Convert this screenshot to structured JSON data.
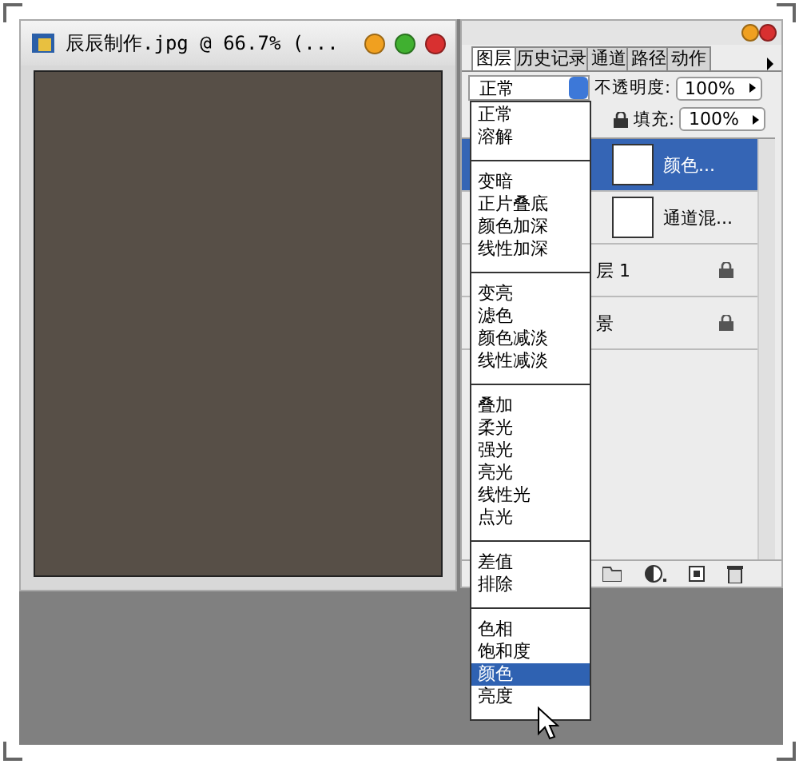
{
  "document_window": {
    "title": "辰辰制作.jpg @ 66.7% (..."
  },
  "layers_panel": {
    "tabs": [
      {
        "label": "图层",
        "selected": true
      },
      {
        "label": "历史记录",
        "selected": false
      },
      {
        "label": "通道",
        "selected": false
      },
      {
        "label": "路径",
        "selected": false
      },
      {
        "label": "动作",
        "selected": false
      }
    ],
    "blend_mode": "正常",
    "opacity_label": "不透明度:",
    "opacity": "100%",
    "fill_label": "填充:",
    "fill": "100%",
    "layers": [
      {
        "name": "颜色...",
        "kind": "adjustment",
        "selected": true,
        "locked": false
      },
      {
        "name": "通道混...",
        "kind": "adjustment",
        "selected": false,
        "locked": false
      },
      {
        "name": "层 1",
        "kind": "pixel",
        "selected": false,
        "locked": true
      },
      {
        "name": "景",
        "kind": "pixel",
        "selected": false,
        "locked": true
      }
    ]
  },
  "blend_menu": {
    "groups": [
      {
        "items": [
          {
            "label": "正常",
            "selected": false
          },
          {
            "label": "溶解",
            "selected": false
          }
        ]
      },
      {
        "items": [
          {
            "label": "变暗",
            "selected": false
          },
          {
            "label": "正片叠底",
            "selected": false
          },
          {
            "label": "颜色加深",
            "selected": false
          },
          {
            "label": "线性加深",
            "selected": false
          }
        ]
      },
      {
        "items": [
          {
            "label": "变亮",
            "selected": false
          },
          {
            "label": "滤色",
            "selected": false
          },
          {
            "label": "颜色减淡",
            "selected": false
          },
          {
            "label": "线性减淡",
            "selected": false
          }
        ]
      },
      {
        "items": [
          {
            "label": "叠加",
            "selected": false
          },
          {
            "label": "柔光",
            "selected": false
          },
          {
            "label": "强光",
            "selected": false
          },
          {
            "label": "亮光",
            "selected": false
          },
          {
            "label": "线性光",
            "selected": false
          },
          {
            "label": "点光",
            "selected": false
          }
        ]
      },
      {
        "items": [
          {
            "label": "差值",
            "selected": false
          },
          {
            "label": "排除",
            "selected": false
          }
        ]
      },
      {
        "items": [
          {
            "label": "色相",
            "selected": false
          },
          {
            "label": "饱和度",
            "selected": false
          },
          {
            "label": "颜色",
            "selected": true
          },
          {
            "label": "亮度",
            "selected": false
          }
        ]
      }
    ]
  }
}
